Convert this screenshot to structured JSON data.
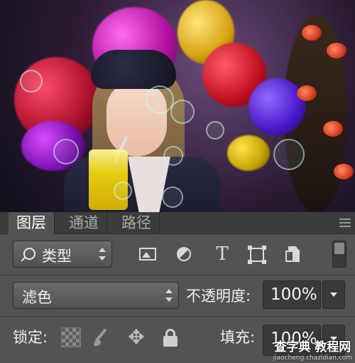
{
  "panel": {
    "tabs": [
      {
        "label": "图层",
        "active": true
      },
      {
        "label": "通道",
        "active": false
      },
      {
        "label": "路径",
        "active": false
      }
    ],
    "filter": {
      "kind_label": "类型",
      "filter_icons": [
        "image-filter-icon",
        "adjustment-filter-icon",
        "type-filter-icon",
        "shape-filter-icon",
        "smart-object-filter-icon"
      ],
      "type_glyph": "T"
    },
    "blend": {
      "mode": "滤色",
      "opacity_label": "不透明度:",
      "opacity_value": "100%"
    },
    "lock": {
      "label": "锁定:",
      "icons": [
        "lock-transparent-icon",
        "lock-image-icon",
        "lock-position-icon",
        "lock-all-icon"
      ],
      "move_glyph": "✥",
      "fill_label": "填充:",
      "fill_value": "100%"
    }
  },
  "watermark": {
    "text": "查字典 教程网",
    "url": "jiaocheng.chazidian.com"
  },
  "colors": {
    "panel_bg": "#535353",
    "tabbar_bg": "#3c3c3c",
    "field_bg": "#3a3a3a"
  }
}
